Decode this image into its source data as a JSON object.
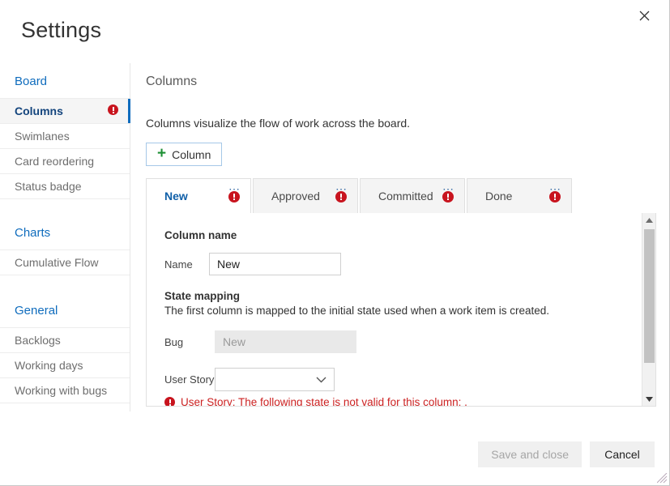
{
  "window": {
    "title": "Settings",
    "close_icon": "close-icon",
    "resize_grip": "resize-grip"
  },
  "sidebar": {
    "groups": [
      {
        "heading": "Board",
        "items": [
          {
            "label": "Columns",
            "selected": true,
            "has_error": true
          },
          {
            "label": "Swimlanes",
            "selected": false,
            "has_error": false
          },
          {
            "label": "Card reordering",
            "selected": false,
            "has_error": false
          },
          {
            "label": "Status badge",
            "selected": false,
            "has_error": false
          }
        ]
      },
      {
        "heading": "Charts",
        "items": [
          {
            "label": "Cumulative Flow",
            "selected": false,
            "has_error": false
          }
        ]
      },
      {
        "heading": "General",
        "items": [
          {
            "label": "Backlogs",
            "selected": false,
            "has_error": false
          },
          {
            "label": "Working days",
            "selected": false,
            "has_error": false
          },
          {
            "label": "Working with bugs",
            "selected": false,
            "has_error": false
          }
        ]
      }
    ]
  },
  "main": {
    "title": "Columns",
    "description": "Columns visualize the flow of work across the board.",
    "add_column_label": "Column",
    "add_column_icon": "plus-icon",
    "tabs": [
      {
        "label": "New",
        "active": true,
        "has_error": true,
        "menu_icon": "ellipsis-icon"
      },
      {
        "label": "Approved",
        "active": false,
        "has_error": true,
        "menu_icon": "ellipsis-icon"
      },
      {
        "label": "Committed",
        "active": false,
        "has_error": true,
        "menu_icon": "ellipsis-icon"
      },
      {
        "label": "Done",
        "active": false,
        "has_error": true,
        "menu_icon": "ellipsis-icon"
      }
    ],
    "form": {
      "column_name_heading": "Column name",
      "name_label": "Name",
      "name_value": "New",
      "state_mapping_heading": "State mapping",
      "state_mapping_description": "The first column is mapped to the initial state used when a work item is created.",
      "bug_label": "Bug",
      "bug_value": "New",
      "user_story_label": "User Story",
      "user_story_value": "",
      "user_story_chevron": "chevron-down-icon",
      "error_message": "User Story: The following state is not valid for this column: .",
      "error_icon": "error-icon"
    },
    "scrollbar": {
      "up_icon": "scroll-up-arrow-icon",
      "down_icon": "scroll-down-arrow-icon"
    }
  },
  "footer": {
    "save_label": "Save and close",
    "save_disabled": true,
    "cancel_label": "Cancel"
  },
  "colors": {
    "accent": "#0f6cbd",
    "error": "#c8141e",
    "error_text": "#cc2222",
    "plus_green": "#1d8f34",
    "tab_active_text": "#0f5fa8"
  }
}
